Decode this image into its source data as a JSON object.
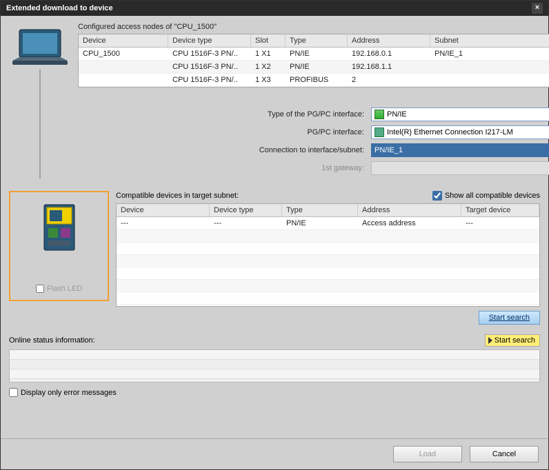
{
  "title": "Extended download to device",
  "configured_label": "Configured access nodes of \"CPU_1500\"",
  "grid1_headers": [
    "Device",
    "Device type",
    "Slot",
    "Type",
    "Address",
    "Subnet"
  ],
  "grid1_rows": [
    [
      "CPU_1500",
      "CPU 1516F-3 PN/..",
      "1 X1",
      "PN/IE",
      "192.168.0.1",
      "PN/IE_1"
    ],
    [
      "",
      "CPU 1516F-3 PN/..",
      "1 X2",
      "PN/IE",
      "192.168.1.1",
      ""
    ],
    [
      "",
      "CPU 1516F-3 PN/..",
      "1 X3",
      "PROFIBUS",
      "2",
      ""
    ]
  ],
  "form": {
    "type_label": "Type of the PG/PC interface:",
    "type_value": "PN/IE",
    "iface_label": "PG/PC interface:",
    "iface_value": "Intel(R) Ethernet Connection I217-LM",
    "conn_label": "Connection to interface/subnet:",
    "conn_value": "PN/IE_1",
    "gateway_label": "1st gateway:",
    "gateway_value": ""
  },
  "compat_label": "Compatible devices in target subnet:",
  "showall_label": "Show all compatible devices",
  "showall_checked": true,
  "grid2_headers": [
    "Device",
    "Device type",
    "Type",
    "Address",
    "Target device"
  ],
  "grid2_rows": [
    [
      "---",
      "---",
      "PN/IE",
      "Access address",
      "---"
    ]
  ],
  "flash_led_label": "Flash LED",
  "start_search_btn": "Start search",
  "status_label": "Online status information:",
  "status_badge": "Start search",
  "error_only_label": "Display only error messages",
  "footer": {
    "load": "Load",
    "cancel": "Cancel"
  }
}
